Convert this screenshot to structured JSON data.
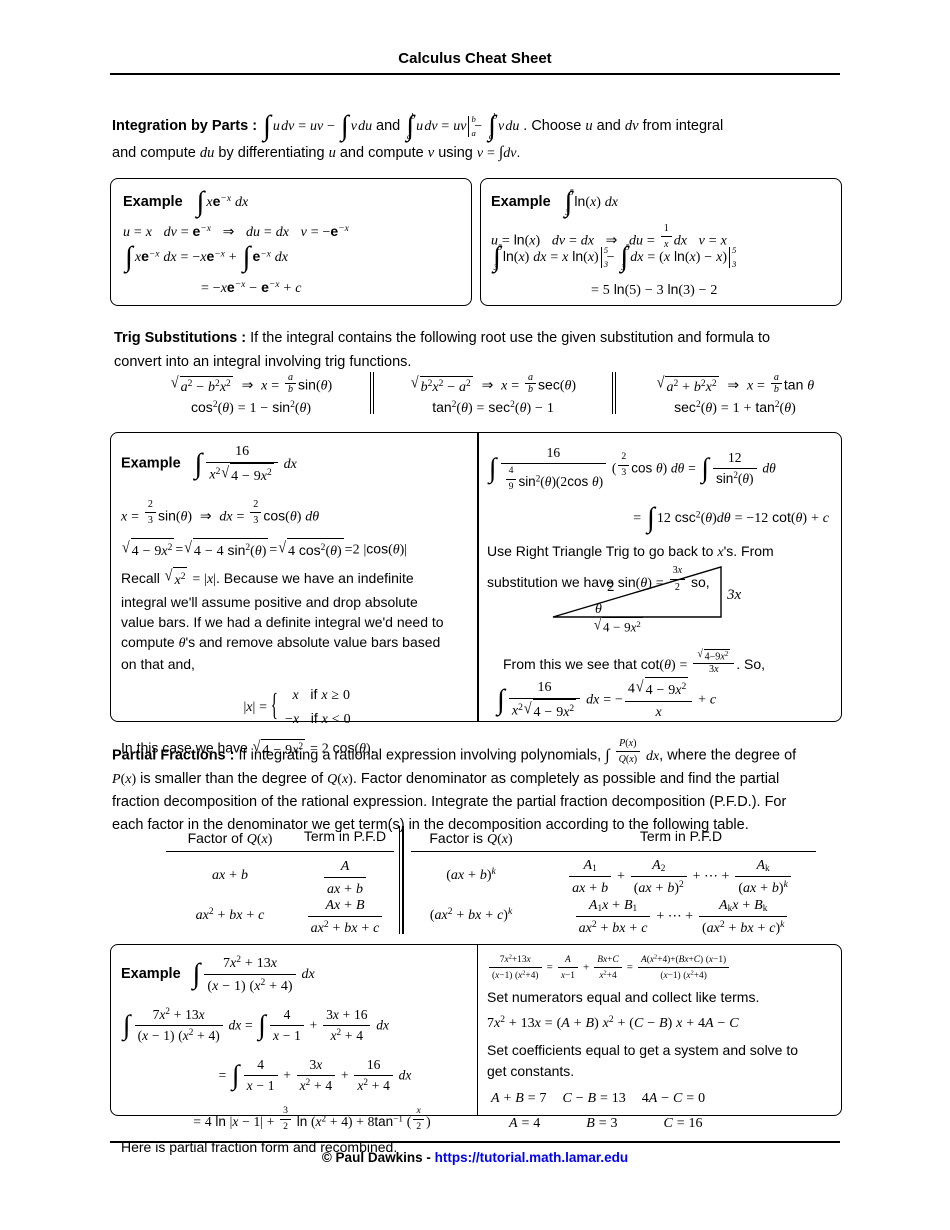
{
  "document": {
    "title": "Calculus Cheat Sheet",
    "footer_author": "© Paul Dawkins - ",
    "footer_url": "https://tutorial.math.lamar.edu",
    "footer_url_color": "#0000ee"
  },
  "sections": {
    "integration_by_parts": {
      "label": "Integration by Parts :",
      "body_a": "and",
      "body_b": ". Choose",
      "body_c": "and",
      "body_d": "from integral",
      "line2_a": "and compute",
      "line2_b": "by differentiating",
      "line2_c": "and compute",
      "line2_d": "using",
      "formula_indefinite": "∫ u dv = uv − ∫ v du",
      "formula_definite": "∫_a^b u dv = uv|_a^b − ∫_a^b v du",
      "u": "u",
      "dv": "dv",
      "du": "du",
      "v": "v",
      "v_eq": "v = ∫ dv"
    },
    "trig_substitutions": {
      "label": "Trig Substitutions :",
      "body_line1": "If the integral contains the following root use the given substitution and formula to",
      "body_line2": "convert into an integral involving trig functions.",
      "cases": [
        {
          "root": "√(a² − b²x²)",
          "sub": "x = (a/b) sin(θ)",
          "identity": "cos²(θ) = 1 − sin²(θ)"
        },
        {
          "root": "√(b²x² − a²)",
          "sub": "x = (a/b) sec(θ)",
          "identity": "tan²(θ) = sec²(θ) − 1"
        },
        {
          "root": "√(a² + b²x²)",
          "sub": "x = (a/b) tan θ",
          "identity": "sec²(θ) = 1 + tan²(θ)"
        }
      ]
    },
    "partial_fractions": {
      "label": "Partial Fractions :",
      "body_line1_a": "If integrating a rational expression involving polynomials,",
      "body_line1_b": ", where the degree of",
      "body_line2_a": "is smaller than the degree of",
      "body_line2_b": ". Factor denominator as completely as possible and find the partial",
      "body_line3": "fraction decomposition of the rational expression.  Integrate the partial fraction decomposition (P.F.D.).  For",
      "body_line4": "each factor in the denominator we get term(s) in the decomposition according to the following table.",
      "integrand": "∫ P(x)/Q(x) dx",
      "P": "P(x)",
      "Q": "Q(x)",
      "table": {
        "headers": [
          "Factor of Q(x)",
          "Term in P.F.D",
          "Factor is Q(x)",
          "Term in P.F.D"
        ],
        "rows": [
          {
            "factor_left": "ax + b",
            "term_left": "A / (ax + b)",
            "factor_right": "(ax + b)^k",
            "term_right": "A₁/(ax+b) + A₂/(ax+b)² + ··· + Aₖ/(ax+b)^k"
          },
          {
            "factor_left": "ax² + bx + c",
            "term_left": "(Ax + B) / (ax² + bx + c)",
            "factor_right": "(ax² + bx + c)^k",
            "term_right": "(A₁x+B₁)/(ax²+bx+c) + ··· + (Aₖx+Bₖ)/(ax²+bx+c)^k"
          }
        ]
      }
    }
  },
  "examples": {
    "ibp_left": {
      "label": "Example",
      "integral": "∫ x e^(−x) dx",
      "line_setup": "u = x   dv = e^(−x)  ⇒  du = dx   v = −e^(−x)",
      "line_work": "∫ x e^(−x) dx = −x e^(−x) + ∫ e^(−x) dx",
      "line_result": "= −x e^(−x) − e^(−x) + c"
    },
    "ibp_right": {
      "label": "Example",
      "integral": "∫_3^5 ln(x) dx",
      "line_setup": "u = ln(x)   dv = dx  ⇒  du = (1/x) dx   v = x",
      "line_work": "∫_3^5 ln(x) dx = x ln(x)|_3^5 − ∫_3^5 dx = (x ln(x) − x)|_3^5",
      "line_result": "= 5 ln(5) − 3 ln(3) − 2"
    },
    "trigsub": {
      "label": "Example",
      "integral": "∫ 16 / (x² √(4 − 9x²)) dx",
      "left_sub": "x = (2/3) sin(θ)  ⇒  dx = (2/3) cos(θ) dθ",
      "left_root": "√(4 − 9x²) = √(4 − 4 sin²(θ)) = √(4 cos²(θ)) = 2 |cos(θ)|",
      "left_text_1": "Recall √(x²) = |x|.  Because we have an indefinite",
      "left_text_2": "integral we'll assume positive and drop absolute",
      "left_text_3": "value bars.  If we had a definite integral we'd need to",
      "left_text_4": "compute θ's and remove absolute value bars based",
      "left_text_5": "on that and,",
      "abs_case_1": "x    if x ≥ 0",
      "abs_case_2": "−x   if x < 0",
      "abs_label": "|x| =",
      "left_final": "In this case we have √(4 − 9x²) = 2 cos(θ).",
      "right_line1": "∫ 16 / ((4/9) sin²(θ)(2 cos θ)) ((2/3) cos θ) dθ = ∫ 12 / sin²(θ) dθ",
      "right_line2": "= ∫ 12 csc²(θ) dθ = −12 cot(θ) + c",
      "right_text_1": "Use Right Triangle Trig to go back to x's.  From",
      "right_text_2": "substitution we have sin(θ) = 3x/2 so,",
      "triangle": {
        "hypotenuse_label": "2",
        "opposite_label": "3x",
        "adjacent_label": "√(4 − 9x²)",
        "angle_label": "θ"
      },
      "right_text_3": "From this we see that cot(θ) = √(4−9x²)/(3x). So,",
      "right_final": "∫ 16 / (x²√(4 − 9x²)) dx = − 4√(4 − 9x²)/x + c"
    },
    "partial_fractions": {
      "label": "Example",
      "integral": "∫ (7x² + 13x) / ((x − 1)(x² + 4)) dx",
      "left_line1": "∫ (7x² + 13x)/((x − 1)(x² + 4)) dx = ∫ 4/(x − 1) + (3x + 16)/(x² + 4) dx",
      "left_line2": "= ∫ 4/(x − 1) + 3x/(x² + 4) + 16/(x² + 4) dx",
      "left_line3": "= 4 ln|x − 1| + (3/2) ln(x² + 4) + 8 tan⁻¹(x/2)",
      "left_note": "Here is partial fraction form and recombined.",
      "right_line1": "(7x²+13x)/((x−1)(x²+4)) = A/(x−1) + (Bx+C)/(x²+4) = (A(x²+4)+(Bx+C)(x−1))/((x−1)(x²+4))",
      "right_text_1": "Set numerators equal and collect like terms.",
      "right_eq": "7x² + 13x = (A + B) x² + (C − B) x + 4A − C",
      "right_text_2": "Set coefficients equal to get a system and solve to",
      "right_text_3": "get constants.",
      "system": [
        "A + B = 7",
        "C − B = 13",
        "4A − C = 0"
      ],
      "solution": [
        "A = 4",
        "B = 3",
        "C = 16"
      ]
    }
  }
}
